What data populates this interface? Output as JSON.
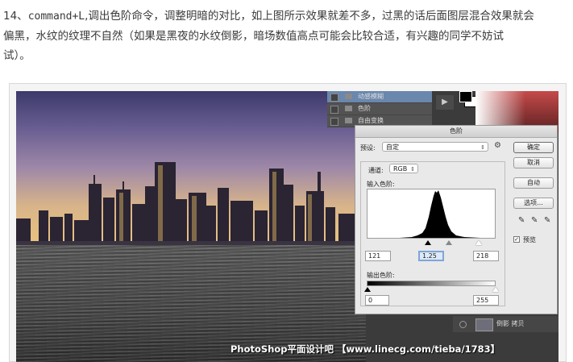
{
  "article": {
    "step_prefix": "14、",
    "command": "command+L",
    "line1_rest": ",调出色阶命令，调整明暗的对比，如上图所示效果就差不多，过黑的话后面图层混合效果就会",
    "line2": "偏黑，水纹的纹理不自然（如果是黑夜的水纹倒影，暗场数值高点可能会比较合适，有兴趣的同学不妨试",
    "line3": "试）。"
  },
  "layers_panel": {
    "rows": [
      {
        "name": "动感模糊",
        "selected": true
      },
      {
        "name": "色阶",
        "selected": false
      },
      {
        "name": "自由变换",
        "selected": false
      }
    ],
    "bottom_layer_name": "倒影 拷贝"
  },
  "dialog": {
    "title": "色阶",
    "preset_label": "预设:",
    "preset_value": "自定",
    "channel_label": "通道:",
    "channel_value": "RGB",
    "input_levels_label": "输入色阶:",
    "output_levels_label": "输出色阶:",
    "input_black": "121",
    "input_gamma": "1.25",
    "input_white": "218",
    "output_black": "0",
    "output_white": "255",
    "buttons": {
      "ok": "确定",
      "cancel": "取消",
      "auto": "自动",
      "options": "选项..."
    },
    "preview_label": "预览",
    "preview_checked": true
  },
  "watermark": "PhotoShop平面设计吧 【www.linecg.com/tieba/1783】",
  "icons": {
    "gear": "gear-icon",
    "eyedroppers": [
      "black-eyedropper-icon",
      "gray-eyedropper-icon",
      "white-eyedropper-icon"
    ],
    "play": "play-icon"
  }
}
